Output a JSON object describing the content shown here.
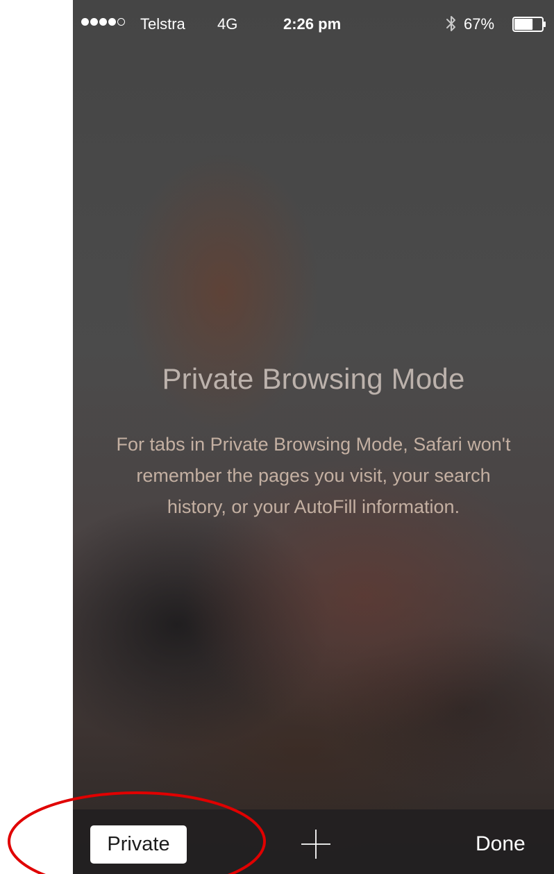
{
  "status_bar": {
    "carrier": "Telstra",
    "network": "4G",
    "time": "2:26 pm",
    "battery_percent": "67%",
    "signal_bars": 4,
    "signal_total": 5,
    "battery_level": 0.67,
    "icons": [
      "signal-icon",
      "bluetooth-icon",
      "battery-icon"
    ]
  },
  "private_mode": {
    "title": "Private Browsing Mode",
    "description": "For tabs in Private Browsing Mode, Safari won't remember the pages you visit, your search history, or your AutoFill information."
  },
  "toolbar": {
    "private_label": "Private",
    "add_tab_icon": "plus-icon",
    "done_label": "Done"
  },
  "annotation": {
    "shape": "ellipse",
    "color": "#e00000",
    "target": "private-button"
  },
  "colors": {
    "toolbar_bg": "#222021",
    "title_text": "#bcb2ac",
    "body_text": "#c4b0a2"
  }
}
